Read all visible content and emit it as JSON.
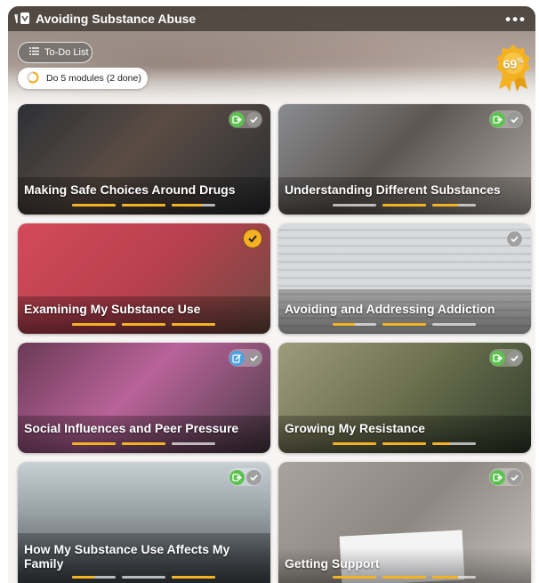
{
  "app": {
    "title": "Avoiding Substance Abuse",
    "more_label": "•••"
  },
  "toolbar": {
    "todo_label": "To-Do List",
    "progress_label": "Do 5 modules (2 done)",
    "badge_percent": "69",
    "badge_percent_sign": "%"
  },
  "colors": {
    "accent": "#f4b223",
    "green_icon": "#5cc24f",
    "blue_icon": "#4aa3df"
  },
  "modules": [
    {
      "title": "Making Safe Choices Around Drugs",
      "status_icon": "green-exit-icon",
      "progress": [
        1.0,
        1.0,
        0.7
      ],
      "bg": "#3a3e44"
    },
    {
      "title": "Understanding Different Substances",
      "status_icon": "green-exit-icon",
      "progress": [
        0.0,
        1.0,
        0.6
      ],
      "bg": "#6a6a6e"
    },
    {
      "title": "Examining My Substance Use",
      "status_icon": "gold-check-icon",
      "progress": [
        1.0,
        1.0,
        1.0
      ],
      "bg": "#c5485a"
    },
    {
      "title": "Avoiding and Addressing Addiction",
      "status_icon": "none",
      "progress": [
        0.5,
        1.0,
        0.0
      ],
      "bg": "#7b7f80"
    },
    {
      "title": "Social Influences and Peer Pressure",
      "status_icon": "blue-edit-icon",
      "progress": [
        1.0,
        1.0,
        0.0
      ],
      "bg": "#8a4e6e"
    },
    {
      "title": "Growing My Resistance",
      "status_icon": "green-exit-icon",
      "progress": [
        1.0,
        1.0,
        0.4
      ],
      "bg": "#6e7350"
    },
    {
      "title": "How My Substance Use Affects My Family",
      "status_icon": "green-exit-icon",
      "progress": [
        0.5,
        0.0,
        1.0
      ],
      "bg": "#6f7a86"
    },
    {
      "title": "Getting Support",
      "status_icon": "green-exit-icon",
      "progress": [
        1.0,
        1.0,
        0.6
      ],
      "bg": "#9a948e"
    }
  ]
}
